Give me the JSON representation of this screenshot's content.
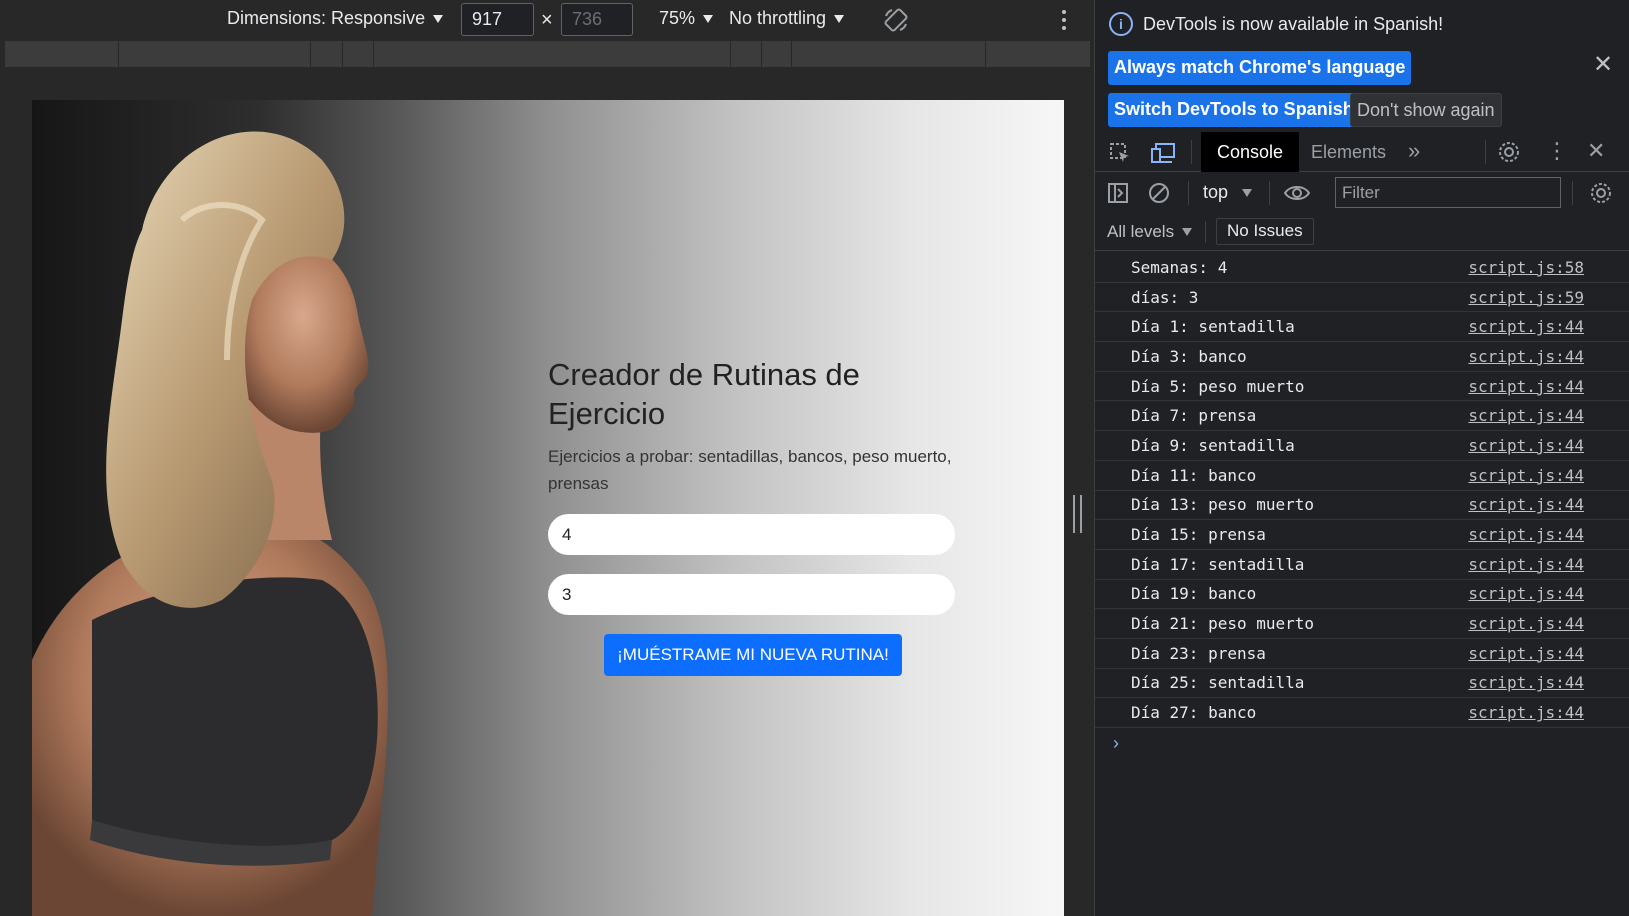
{
  "device_toolbar": {
    "dimensions_label": "Dimensions: Responsive",
    "width_value": "917",
    "height_value": "736",
    "times": "×",
    "zoom": "75%",
    "throttling": "No throttling"
  },
  "app": {
    "title": "Creador de Rutinas de Ejercicio",
    "description": "Ejercicios a probar: sentadillas, bancos, peso muerto, prensas",
    "weeks_value": "4",
    "days_value": "3",
    "submit_label": "¡MUÉSTRAME MI NUEVA RUTINA!"
  },
  "devtools": {
    "info_message": "DevTools is now available in Spanish!",
    "btn_match_language": "Always match Chrome's language",
    "btn_switch_spanish": "Switch DevTools to Spanish",
    "btn_dont_show": "Don't show again",
    "tabs": {
      "console": "Console",
      "elements": "Elements"
    },
    "context": "top",
    "filter_placeholder": "Filter",
    "levels": "All levels",
    "issues": "No Issues",
    "logs": [
      {
        "text": "Semanas: 4",
        "source": "script.js:58"
      },
      {
        "text": "días: 3",
        "source": "script.js:59"
      },
      {
        "text": "Día 1: sentadilla",
        "source": "script.js:44"
      },
      {
        "text": "Día 3: banco",
        "source": "script.js:44"
      },
      {
        "text": "Día 5: peso muerto",
        "source": "script.js:44"
      },
      {
        "text": "Día 7: prensa",
        "source": "script.js:44"
      },
      {
        "text": "Día 9: sentadilla",
        "source": "script.js:44"
      },
      {
        "text": "Día 11: banco",
        "source": "script.js:44"
      },
      {
        "text": "Día 13: peso muerto",
        "source": "script.js:44"
      },
      {
        "text": "Día 15: prensa",
        "source": "script.js:44"
      },
      {
        "text": "Día 17: sentadilla",
        "source": "script.js:44"
      },
      {
        "text": "Día 19: banco",
        "source": "script.js:44"
      },
      {
        "text": "Día 21: peso muerto",
        "source": "script.js:44"
      },
      {
        "text": "Día 23: prensa",
        "source": "script.js:44"
      },
      {
        "text": "Día 25: sentadilla",
        "source": "script.js:44"
      },
      {
        "text": "Día 27: banco",
        "source": "script.js:44"
      }
    ]
  },
  "colors": {
    "primary_button": "#0d6efd",
    "devtools_blue": "#1a73e8",
    "devtools_bg": "#202124"
  }
}
